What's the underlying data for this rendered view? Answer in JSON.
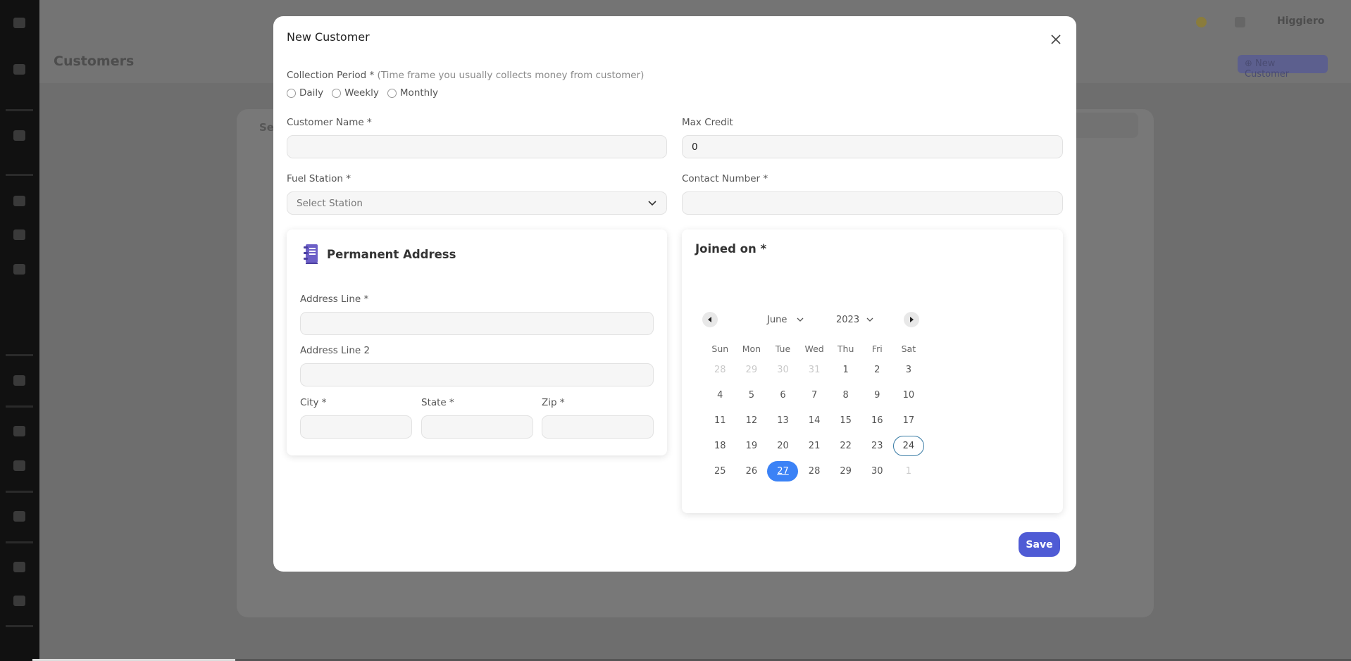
{
  "background": {
    "page_title": "Customers",
    "new_button": "⊕ New Customer",
    "user_name": "Higgiero",
    "card_label": "Se"
  },
  "modal": {
    "title": "New Customer",
    "collection_period": {
      "label": "Collection Period *",
      "hint": "(Time frame you usually collects money from customer)",
      "options": [
        "Daily",
        "Weekly",
        "Monthly"
      ]
    },
    "customer_name": {
      "label": "Customer Name *",
      "value": ""
    },
    "max_credit": {
      "label": "Max Credit",
      "value": "0"
    },
    "fuel_station": {
      "label": "Fuel Station *",
      "placeholder": "Select Station"
    },
    "contact_number": {
      "label": "Contact Number *",
      "value": ""
    },
    "address": {
      "title": "Permanent Address",
      "line1_label": "Address Line *",
      "line2_label": "Address Line 2",
      "city_label": "City *",
      "state_label": "State *",
      "zip_label": "Zip *"
    },
    "joined_on": {
      "title": "Joined on *",
      "month": "June",
      "year": "2023",
      "weekdays": [
        "Sun",
        "Mon",
        "Tue",
        "Wed",
        "Thu",
        "Fri",
        "Sat"
      ],
      "weeks": [
        [
          {
            "d": "28",
            "m": true
          },
          {
            "d": "29",
            "m": true
          },
          {
            "d": "30",
            "m": true
          },
          {
            "d": "31",
            "m": true
          },
          {
            "d": "1"
          },
          {
            "d": "2"
          },
          {
            "d": "3"
          }
        ],
        [
          {
            "d": "4"
          },
          {
            "d": "5"
          },
          {
            "d": "6"
          },
          {
            "d": "7"
          },
          {
            "d": "8"
          },
          {
            "d": "9"
          },
          {
            "d": "10"
          }
        ],
        [
          {
            "d": "11"
          },
          {
            "d": "12"
          },
          {
            "d": "13"
          },
          {
            "d": "14"
          },
          {
            "d": "15"
          },
          {
            "d": "16"
          },
          {
            "d": "17"
          }
        ],
        [
          {
            "d": "18"
          },
          {
            "d": "19"
          },
          {
            "d": "20"
          },
          {
            "d": "21"
          },
          {
            "d": "22"
          },
          {
            "d": "23"
          },
          {
            "d": "24",
            "today": true
          }
        ],
        [
          {
            "d": "25"
          },
          {
            "d": "26"
          },
          {
            "d": "27",
            "selected": true
          },
          {
            "d": "28"
          },
          {
            "d": "29"
          },
          {
            "d": "30"
          },
          {
            "d": "1",
            "m": true
          }
        ]
      ]
    },
    "save_label": "Save"
  },
  "colors": {
    "accent": "#4f5bd5",
    "selected_day": "#3b82f6",
    "today_ring": "#3a7ca5"
  }
}
